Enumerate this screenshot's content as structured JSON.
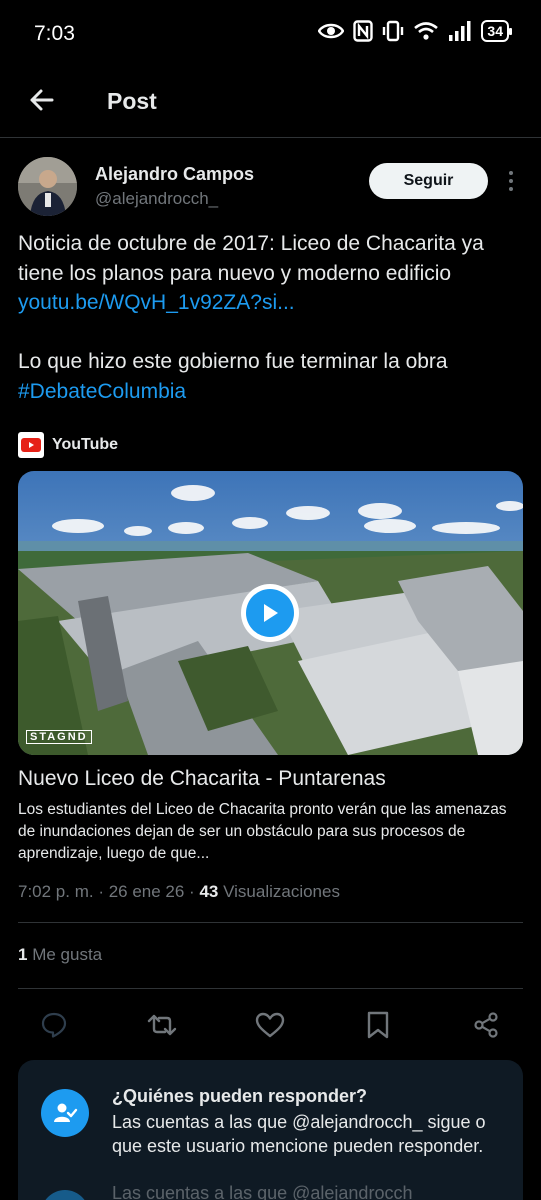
{
  "status_bar": {
    "time": "7:03",
    "battery": "34"
  },
  "header": {
    "title": "Post"
  },
  "post": {
    "author_name": "Alejandro Campos",
    "author_handle": "@alejandrocch_",
    "follow_label": "Seguir",
    "text_line1": "Noticia de octubre de 2017: Liceo de Chacarita ya tiene los planos para nuevo y moderno edificio ",
    "link_text": "youtu.be/WQvH_1v92ZA?si...",
    "text_line2": "Lo que hizo este gobierno fue terminar la obra ",
    "hashtag": "#DebateColumbia",
    "timestamp": "7:02 p. m. · 26 ene 26 · ",
    "views_count": "43",
    "views_label": " Visualizaciones",
    "likes_count": "1",
    "likes_label": " Me gusta"
  },
  "link_card": {
    "source": "YouTube",
    "title": "Nuevo Liceo de Chacarita - Puntarenas",
    "description": "Los estudiantes del Liceo de Chacarita pronto verán que las amenazas de inundaciones dejan de ser un obstáculo para sus procesos de aprendizaje, luego de que...",
    "watermark": "STAGND"
  },
  "actions": [
    "reply-icon",
    "repost-icon",
    "like-icon",
    "bookmark-icon",
    "share-icon"
  ],
  "reply_restriction": {
    "title": "¿Quiénes pueden responder?",
    "description": "Las cuentas a las que @alejandrocch_ sigue o que este usuario mencione pueden responder.",
    "ghost_text": "Las cuentas a las que @alejandrocch_"
  },
  "colors": {
    "background": "#000000",
    "accent": "#1d9bf0",
    "muted": "#71767b",
    "text": "#e7e9ea"
  }
}
